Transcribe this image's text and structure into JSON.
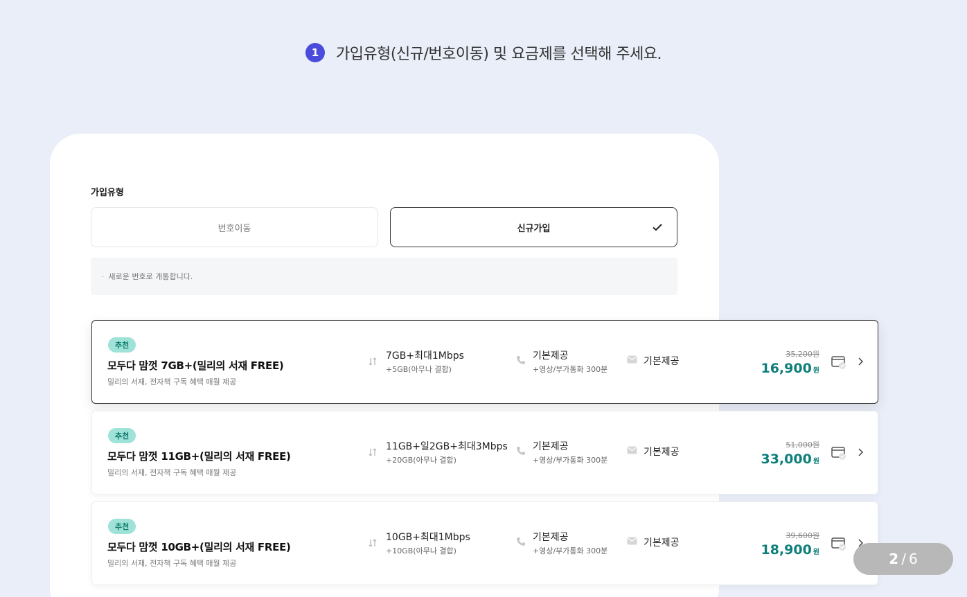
{
  "step": {
    "number": "1",
    "title": "가입유형(신규/번호이동) 및 요금제를 선택해 주세요."
  },
  "join_type": {
    "label": "가입유형",
    "options": [
      "번호이동",
      "신규가입"
    ],
    "selected": "신규가입",
    "notice": "새로운 번호로 개통합니다."
  },
  "plans": [
    {
      "badge": "추천",
      "name": "모두다 맘껏 7GB+(밀리의 서재 FREE)",
      "desc": "밀리의 서재, 전자책 구독 혜택 매월 제공",
      "data_main": "7GB+최대1Mbps",
      "data_sub": "+5GB(아무나 결합)",
      "call_main": "기본제공",
      "call_sub": "+영상/부가통화 300분",
      "sms": "기본제공",
      "price_old": "35,200원",
      "price_new": "16,900",
      "won": "원",
      "selected": true
    },
    {
      "badge": "추천",
      "name": "모두다 맘껏 11GB+(밀리의 서재 FREE)",
      "desc": "밀리의 서재, 전자책 구독 혜택 매월 제공",
      "data_main": "11GB+일2GB+최대3Mbps",
      "data_sub": "+20GB(아무나 결합)",
      "call_main": "기본제공",
      "call_sub": "+영상/부가통화 300분",
      "sms": "기본제공",
      "price_old": "51,000원",
      "price_new": "33,000",
      "won": "원",
      "selected": false
    },
    {
      "badge": "추천",
      "name": "모두다 맘껏 10GB+(밀리의 서재 FREE)",
      "desc": "밀리의 서재, 전자책 구독 혜택 매월 제공",
      "data_main": "10GB+최대1Mbps",
      "data_sub": "+10GB(아무나 결합)",
      "call_main": "기본제공",
      "call_sub": "+영상/부가통화 300분",
      "sms": "기본제공",
      "price_old": "39,600원",
      "price_new": "18,900",
      "won": "원",
      "selected": false
    }
  ],
  "pager": {
    "current": "2",
    "separator": "/",
    "total": "6"
  },
  "colors": {
    "background": "#e9eef8",
    "accent": "#4b4cdc",
    "price": "#0d7f7a",
    "badge_bg": "#9ee2d8"
  },
  "icons": [
    "check-icon",
    "data-arrows-icon",
    "phone-icon",
    "message-icon",
    "cart-icon",
    "chevron-right-icon"
  ]
}
